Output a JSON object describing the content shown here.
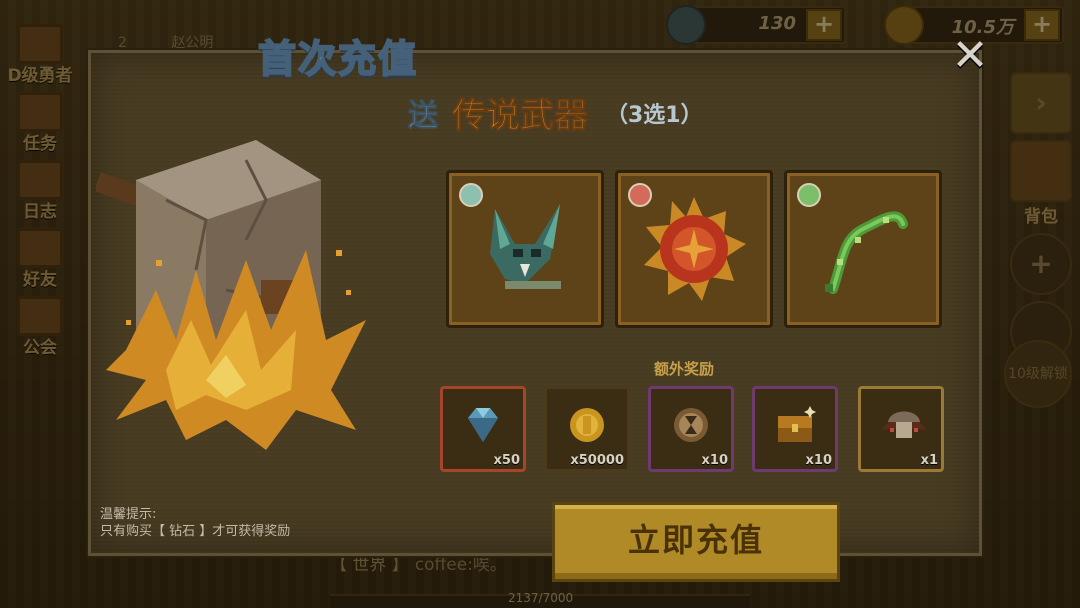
{
  "background": {
    "rank_number": "2",
    "rank_name": "赵公明",
    "left_menu": [
      {
        "label": "D级勇者",
        "icon": "hero-portrait-icon"
      },
      {
        "label": "任务",
        "icon": "quest-icon"
      },
      {
        "label": "日志",
        "icon": "journal-icon"
      },
      {
        "label": "好友",
        "icon": "friends-icon"
      },
      {
        "label": "公会",
        "icon": "guild-banner-icon"
      }
    ],
    "diamond_count": "130",
    "gold_count": "10.5万",
    "backpack_label": "背包",
    "unlock_label": "10级解锁",
    "chat_channel": "【 世界 】",
    "chat_message": "coffee:唉。",
    "exp_text": "2137/7000"
  },
  "modal": {
    "title": "首次充值",
    "close_symbol": "✕",
    "headline_prefix": "送",
    "headline_highlight": "传说武器",
    "headline_suffix": "（3选1）",
    "weapons": [
      {
        "name": "green-fanged-mask",
        "gem_color": "#8ec0b0"
      },
      {
        "name": "red-sun-shield",
        "gem_color": "#d46a5a"
      },
      {
        "name": "thorn-vine-whip",
        "gem_color": "#7bbf6a"
      }
    ],
    "extra_title": "额外奖励",
    "extra_rewards": [
      {
        "icon": "diamond-icon",
        "qty": "x50",
        "frame": "#a5452a"
      },
      {
        "icon": "gold-coin-icon",
        "qty": "x50000",
        "frame": "#4b3a1c"
      },
      {
        "icon": "hourglass-token-icon",
        "qty": "x10",
        "frame": "#6e3a70"
      },
      {
        "icon": "treasure-chest-icon",
        "qty": "x10",
        "frame": "#6e3a70"
      },
      {
        "icon": "winged-mushroom-icon",
        "qty": "x1",
        "frame": "#9a7a34"
      }
    ],
    "tip_title": "温馨提示:",
    "tip_text": "只有购买【 钻石 】才可获得奖励",
    "charge_button": "立即充值"
  }
}
